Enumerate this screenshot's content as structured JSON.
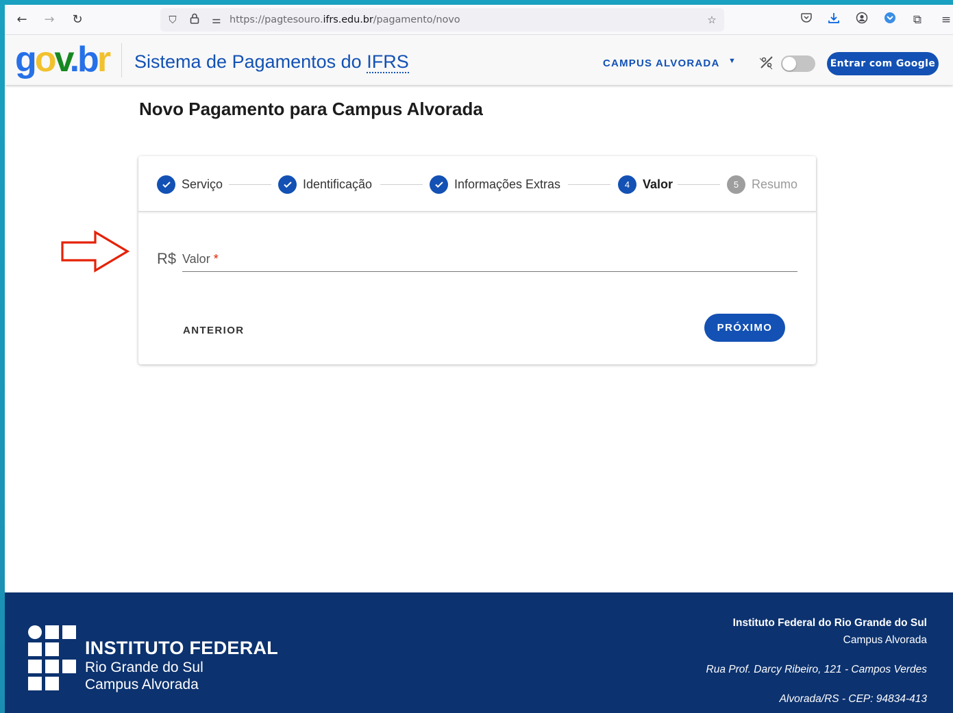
{
  "browser": {
    "url_prefix": "https://pagtesouro.",
    "url_host": "ifrs.edu.br",
    "url_path": "/pagamento/novo"
  },
  "header": {
    "logo_text": "gov.br",
    "app_title_prefix": "Sistema de Pagamentos do ",
    "app_title_abbr": "IFRS",
    "campus_select": "CAMPUS ALVORADA",
    "login_button": "Entrar com Google"
  },
  "page": {
    "title": "Novo Pagamento para Campus Alvorada"
  },
  "stepper": {
    "steps": [
      {
        "label": "Serviço",
        "state": "done"
      },
      {
        "label": "Identificação",
        "state": "done"
      },
      {
        "label": "Informações Extras",
        "state": "done"
      },
      {
        "label": "Valor",
        "state": "active",
        "number": "4"
      },
      {
        "label": "Resumo",
        "state": "pending",
        "number": "5"
      }
    ]
  },
  "form": {
    "currency": "R$",
    "field_label": "Valor",
    "required_mark": "*",
    "value": ""
  },
  "actions": {
    "previous": "ANTERIOR",
    "next": "PRÓXIMO"
  },
  "footer": {
    "logo_title": "INSTITUTO FEDERAL",
    "logo_sub1": "Rio Grande do Sul",
    "logo_sub2": "Campus Alvorada",
    "institution": "Instituto Federal do Rio Grande do Sul",
    "campus": "Campus Alvorada",
    "address": "Rua Prof. Darcy Ribeiro, 121 - Campos Verdes",
    "city": "Alvorada/RS - CEP: 94834-413"
  },
  "colors": {
    "primary": "#1351b4",
    "footer_bg": "#0c326f",
    "annotation_arrow": "#e52207"
  }
}
